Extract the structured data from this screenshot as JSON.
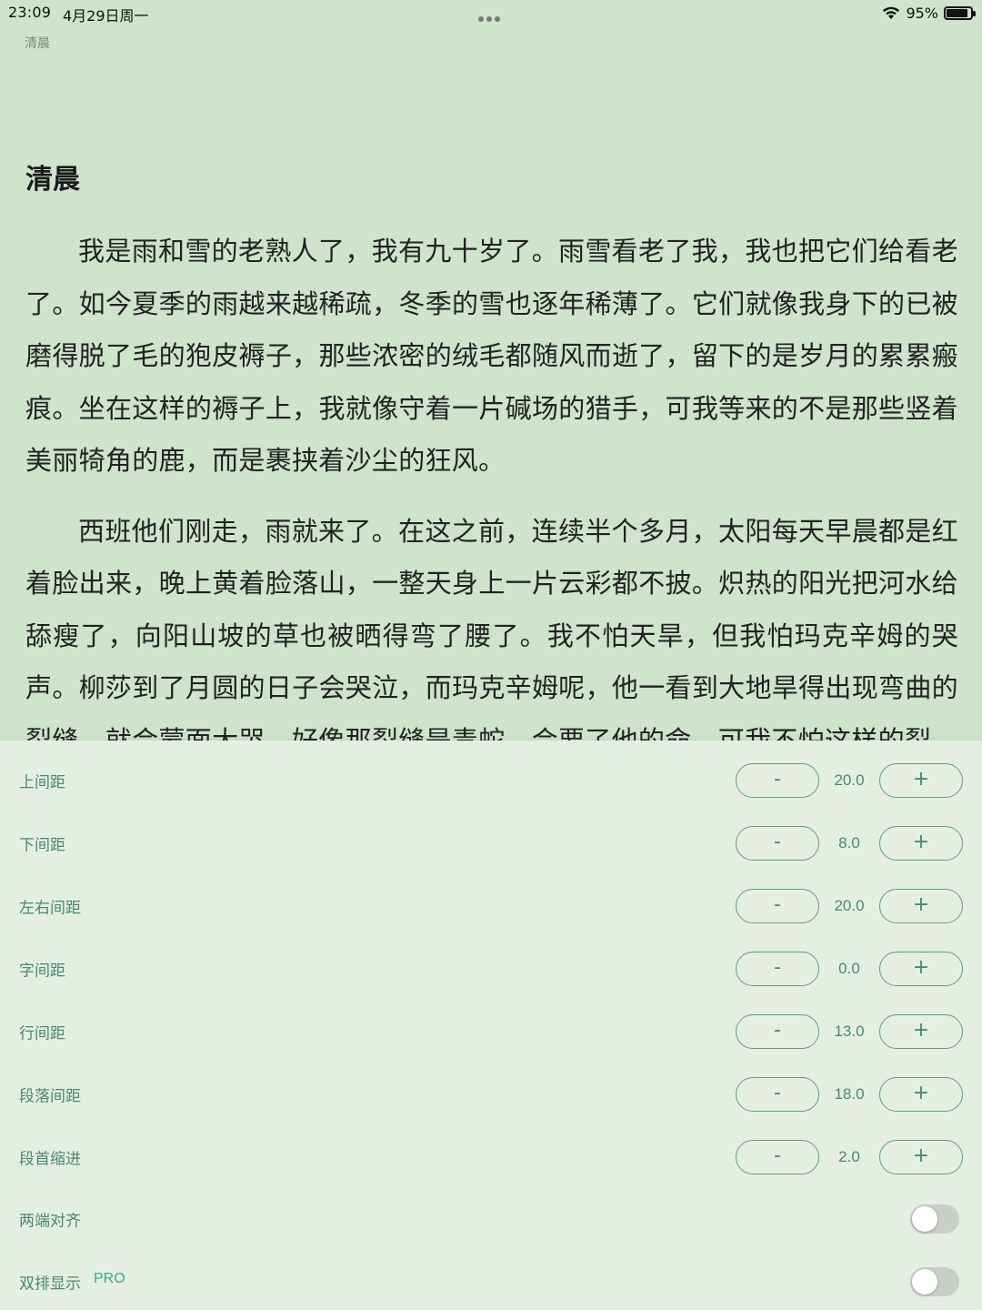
{
  "status_bar": {
    "time": "23:09",
    "date": "4月29日周一",
    "battery_text": "95%",
    "battery_level": 0.95
  },
  "reader": {
    "book_title": "清晨",
    "chapter_title": "清晨",
    "paragraphs": [
      "我是雨和雪的老熟人了，我有九十岁了。雨雪看老了我，我也把它们给看老了。如今夏季的雨越来越稀疏，冬季的雪也逐年稀薄了。它们就像我身下的已被磨得脱了毛的狍皮褥子，那些浓密的绒毛都随风而逝了，留下的是岁月的累累瘢痕。坐在这样的褥子上，我就像守着一片碱场的猎手，可我等来的不是那些竖着美丽犄角的鹿，而是裹挟着沙尘的狂风。",
      "西班他们刚走，雨就来了。在这之前，连续半个多月，太阳每天早晨都是红着脸出来，晚上黄着脸落山，一整天身上一片云彩都不披。炽热的阳光把河水给舔瘦了，向阳山坡的草也被晒得弯了腰了。我不怕天旱，但我怕玛克辛姆的哭声。柳莎到了月圆的日子会哭泣，而玛克辛姆呢，他一看到大地旱得出现弯曲的裂缝，就会蒙面大哭，好像那裂缝是毒蛇，会要了他的命。可我不怕这样的裂"
    ]
  },
  "settings": {
    "steppers": [
      {
        "label": "上间距",
        "value": "20.0",
        "minus": "-",
        "plus": "+"
      },
      {
        "label": "下间距",
        "value": "8.0",
        "minus": "-",
        "plus": "+"
      },
      {
        "label": "左右间距",
        "value": "20.0",
        "minus": "-",
        "plus": "+"
      },
      {
        "label": "字间距",
        "value": "0.0",
        "minus": "-",
        "plus": "+"
      },
      {
        "label": "行间距",
        "value": "13.0",
        "minus": "-",
        "plus": "+"
      },
      {
        "label": "段落间距",
        "value": "18.0",
        "minus": "-",
        "plus": "+"
      },
      {
        "label": "段首缩进",
        "value": "2.0",
        "minus": "-",
        "plus": "+"
      }
    ],
    "toggles": [
      {
        "label": "两端对齐",
        "on": false
      },
      {
        "label": "双排显示",
        "badge": "PRO",
        "on": false
      }
    ],
    "accent_color": "#4a8a6a",
    "badge_color": "#3daa8a"
  }
}
